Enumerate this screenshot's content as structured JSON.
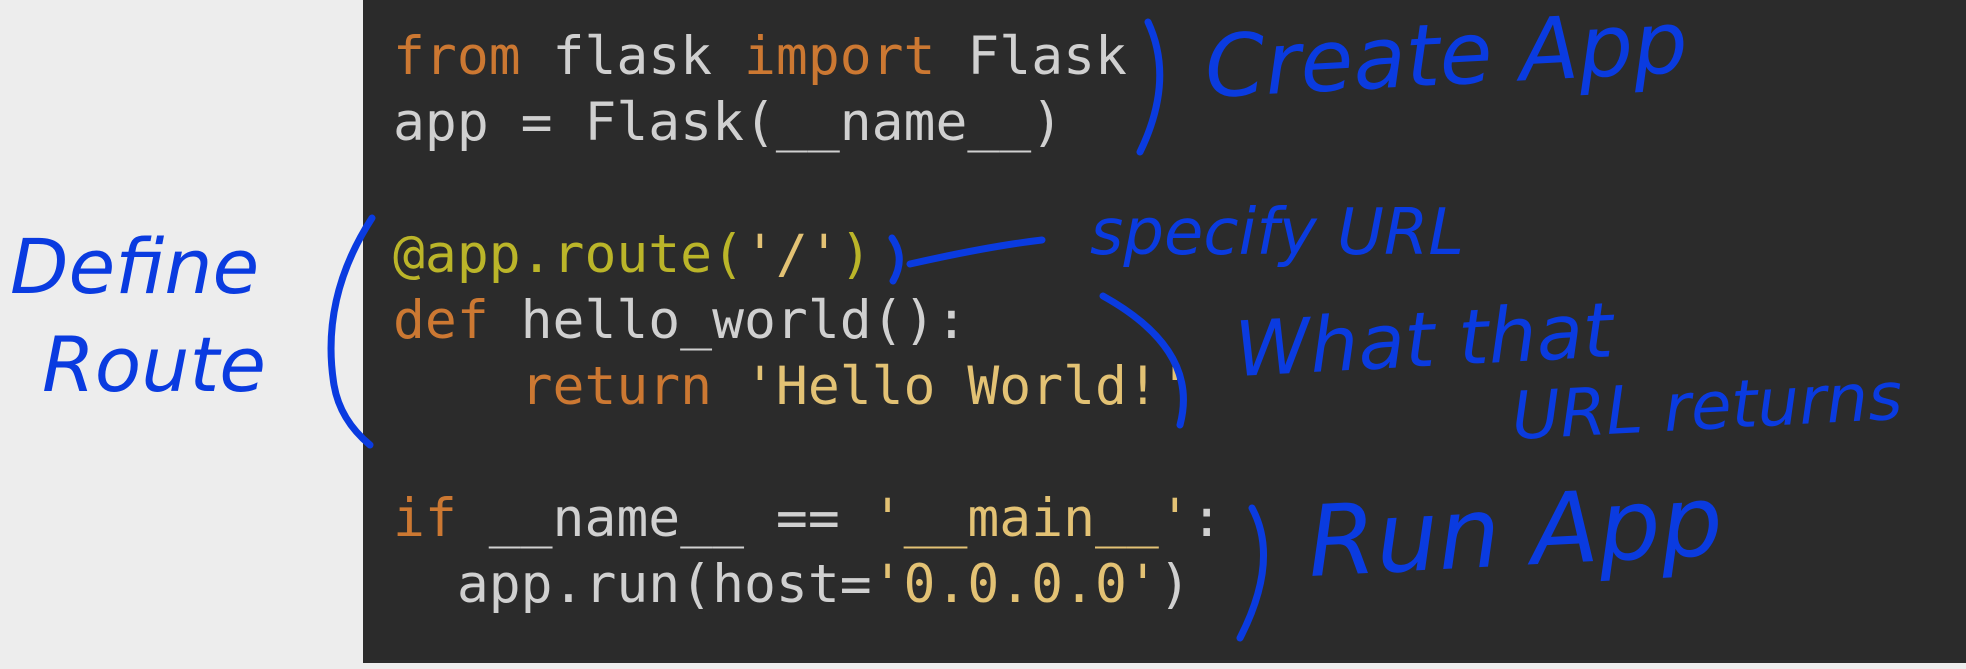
{
  "code": {
    "lines": [
      [
        {
          "t": "from",
          "c": "kw"
        },
        {
          "t": " flask ",
          "c": "plain"
        },
        {
          "t": "import",
          "c": "kw"
        },
        {
          "t": " Flask",
          "c": "plain"
        }
      ],
      [
        {
          "t": "app = Flask(__name__)",
          "c": "plain"
        }
      ],
      [],
      [
        {
          "t": "@app.route(",
          "c": "dec"
        },
        {
          "t": "'/'",
          "c": "str"
        },
        {
          "t": ")",
          "c": "dec"
        }
      ],
      [
        {
          "t": "def",
          "c": "kw"
        },
        {
          "t": " hello_world():",
          "c": "plain"
        }
      ],
      [
        {
          "t": "    ",
          "c": "plain"
        },
        {
          "t": "return",
          "c": "kw"
        },
        {
          "t": " ",
          "c": "plain"
        },
        {
          "t": "'Hello World!'",
          "c": "str"
        }
      ],
      [],
      [
        {
          "t": "if",
          "c": "kw"
        },
        {
          "t": " __name__ == ",
          "c": "plain"
        },
        {
          "t": "'__main__'",
          "c": "str"
        },
        {
          "t": ":",
          "c": "plain"
        }
      ],
      [
        {
          "t": "  app.run(host=",
          "c": "plain"
        },
        {
          "t": "'0.0.0.0'",
          "c": "str"
        },
        {
          "t": ")",
          "c": "plain"
        }
      ]
    ]
  },
  "annotations": {
    "create_app": "Create App",
    "specify_url": "specify URL",
    "what_that": "What that",
    "url_returns": "URL returns",
    "run_app": "Run App",
    "define": "Define",
    "route": "Route"
  },
  "colors": {
    "background": "#ededed",
    "code_panel": "#2b2b2b",
    "keyword": "#cc7832",
    "string": "#e3c274",
    "decorator": "#bbb529",
    "plain": "#d0d0d0",
    "ink": "#0a3be0"
  }
}
